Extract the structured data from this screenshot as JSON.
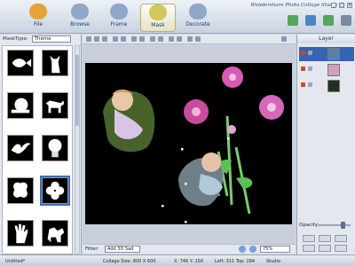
{
  "window": {
    "title": "Wondershare Photo Collage Studio",
    "controls": [
      "_",
      "□",
      "×"
    ]
  },
  "tabs": [
    {
      "label": "File",
      "icon": "folder-icon",
      "color": "#e8a23a"
    },
    {
      "label": "Browse",
      "icon": "browse-icon",
      "color": "#8fa7c9"
    },
    {
      "label": "Frame",
      "icon": "frame-icon",
      "color": "#8fa7c9"
    },
    {
      "label": "Mask",
      "icon": "mask-icon",
      "color": "#d1c75e",
      "active": true
    },
    {
      "label": "Decorate",
      "icon": "decorate-icon",
      "color": "#8fa7c9"
    }
  ],
  "right_tools": [
    {
      "icon": "publish-icon",
      "color": "#5aa35a"
    },
    {
      "icon": "save-icon",
      "color": "#4a86c5"
    },
    {
      "icon": "email-icon",
      "color": "#5aa35a"
    },
    {
      "icon": "print-icon",
      "color": "#7a8aa0"
    }
  ],
  "left_panel": {
    "mask_type_label": "MaskType:",
    "mask_type_value": "Theme",
    "masks": [
      "fish-mask-icon",
      "cat-mask-icon",
      "snail-mask-icon",
      "dog-mask-icon",
      "bird-mask-icon",
      "bulb-mask-icon",
      "butterfly-mask-icon",
      "flower-mask-icon",
      "hand-mask-icon",
      "cow-mask-icon"
    ]
  },
  "filter": {
    "label": "Filter:",
    "value": "Add 3D Sad",
    "zoom": "75%"
  },
  "layers": {
    "title": "Layer",
    "items": [
      {
        "thumb_color": "#5a7fb0",
        "active": true
      },
      {
        "thumb_color": "#d0a0c0"
      },
      {
        "thumb_color": "#203020"
      }
    ],
    "opacity_label": "Opacity:",
    "opacity_value": 0.8
  },
  "status": {
    "state": "Untitled*",
    "collage_size": "Collage Size: 800 X 600",
    "position": "X: 746 Y: 156",
    "bounds": "Left: 311 Top: 284",
    "mode": "Studio"
  }
}
